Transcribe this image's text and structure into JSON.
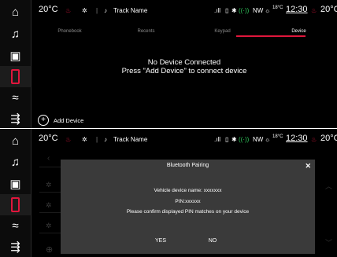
{
  "status": {
    "temp_left": "20",
    "temp_unit_left": "°C",
    "track": "Track Name",
    "compass": "NW",
    "outside_temp": "18°C",
    "clock": "12:30",
    "temp_right": "20",
    "temp_unit_right": "°C"
  },
  "sidebar_icons": [
    "home-icon",
    "music-icon",
    "radio-icon",
    "phone-icon",
    "climate-icon",
    "apps-icon"
  ],
  "tabs": [
    "Phonebook",
    "Recents",
    "Keypad",
    "Device"
  ],
  "active_tab": "Device",
  "empty": {
    "line1": "No Device Connected",
    "line2": "Press \"Add Device\" to connect device"
  },
  "add_device_label": "Add Device",
  "dialog": {
    "title": "Bluetooth Pairing",
    "close": "✕",
    "vehicle_name": "Vehicle device name: xxxxxxx",
    "pin": "PIN:xxxxxx",
    "confirm": "Please confirm displayed PIN matches on your device",
    "yes": "YES",
    "no": "NO"
  },
  "colors": {
    "accent": "#e0163c",
    "background": "#000000",
    "dialog": "#3a3a3a"
  }
}
